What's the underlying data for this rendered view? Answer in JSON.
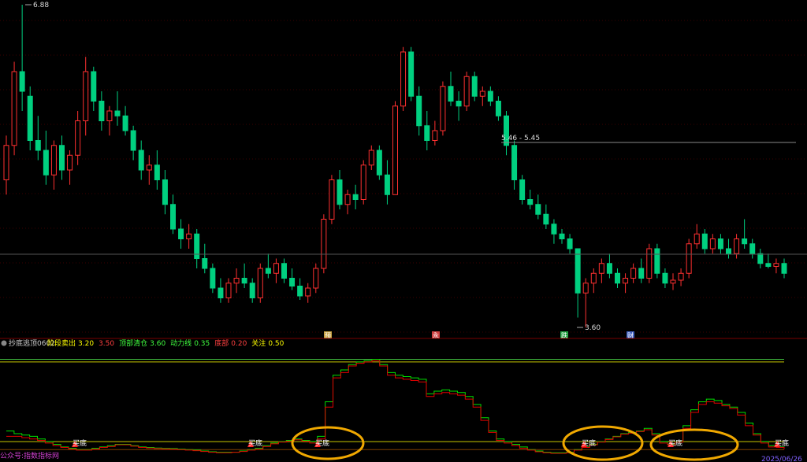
{
  "price_panel": {
    "high_label": "6.88",
    "low_label": "3.60",
    "range_label": "5.46 - 5.45",
    "badges": [
      {
        "text": "预",
        "color": "#c8a040"
      },
      {
        "text": "永",
        "color": "#d04040"
      },
      {
        "text": "跌",
        "color": "#20a040"
      },
      {
        "text": "财",
        "color": "#4060c0"
      }
    ]
  },
  "indicator_header": {
    "name": "抄底逃顶0602",
    "items": [
      {
        "label": "阶段卖出",
        "value": "3.20",
        "color": "#ffff00"
      },
      {
        "label": "",
        "value": "3.50",
        "color": "#ff4040"
      },
      {
        "label": "顶部清仓",
        "value": "3.60",
        "color": "#40ff40"
      },
      {
        "label": "动力线",
        "value": "0.35",
        "color": "#40ff40"
      },
      {
        "label": "底部",
        "value": "0.20",
        "color": "#ff4040"
      },
      {
        "label": "关注",
        "value": "0.50",
        "color": "#ffff00"
      }
    ]
  },
  "signals": [
    "买底",
    "买底",
    "买底",
    "买底",
    "买底",
    "买底"
  ],
  "footer": {
    "left_text": "公众号:指数指标网",
    "right_date": "2025/06/26"
  },
  "colors": {
    "up": "#ff3030",
    "down": "#00d080",
    "grid": "#7a0000",
    "highlight_ellipse": "#f0a800",
    "line_top": "#40c040",
    "line_mid": "#c8c800"
  },
  "chart_data": [
    {
      "type": "candlestick",
      "title": "",
      "y_axis": {
        "high": 6.88,
        "low": 3.6
      },
      "candles": [
        [
          5.1,
          5.55,
          4.95,
          5.45
        ],
        [
          5.45,
          6.3,
          5.35,
          6.2
        ],
        [
          6.2,
          6.88,
          5.8,
          6.0
        ],
        [
          5.95,
          6.05,
          5.4,
          5.5
        ],
        [
          5.5,
          5.75,
          5.3,
          5.4
        ],
        [
          5.4,
          5.6,
          5.05,
          5.15
        ],
        [
          5.15,
          5.5,
          5.0,
          5.45
        ],
        [
          5.45,
          5.55,
          5.1,
          5.2
        ],
        [
          5.2,
          5.4,
          5.05,
          5.35
        ],
        [
          5.35,
          5.8,
          5.25,
          5.7
        ],
        [
          5.7,
          6.35,
          5.55,
          6.2
        ],
        [
          6.2,
          6.25,
          5.8,
          5.9
        ],
        [
          5.9,
          6.0,
          5.6,
          5.7
        ],
        [
          5.7,
          5.85,
          5.55,
          5.8
        ],
        [
          5.8,
          6.0,
          5.65,
          5.75
        ],
        [
          5.75,
          5.85,
          5.55,
          5.6
        ],
        [
          5.6,
          5.65,
          5.3,
          5.4
        ],
        [
          5.4,
          5.5,
          5.1,
          5.2
        ],
        [
          5.2,
          5.35,
          5.05,
          5.25
        ],
        [
          5.25,
          5.4,
          5.0,
          5.1
        ],
        [
          5.1,
          5.2,
          4.75,
          4.85
        ],
        [
          4.85,
          4.95,
          4.55,
          4.6
        ],
        [
          4.6,
          4.7,
          4.4,
          4.5
        ],
        [
          4.5,
          4.65,
          4.4,
          4.55
        ],
        [
          4.55,
          4.6,
          4.2,
          4.3
        ],
        [
          4.3,
          4.45,
          4.15,
          4.2
        ],
        [
          4.2,
          4.25,
          3.95,
          4.0
        ],
        [
          4.0,
          4.1,
          3.85,
          3.9
        ],
        [
          3.9,
          4.1,
          3.85,
          4.05
        ],
        [
          4.05,
          4.2,
          3.95,
          4.1
        ],
        [
          4.1,
          4.25,
          4.0,
          4.05
        ],
        [
          4.05,
          4.1,
          3.85,
          3.9
        ],
        [
          3.9,
          4.25,
          3.85,
          4.2
        ],
        [
          4.2,
          4.35,
          4.1,
          4.15
        ],
        [
          4.15,
          4.3,
          4.05,
          4.25
        ],
        [
          4.25,
          4.3,
          4.05,
          4.1
        ],
        [
          4.1,
          4.2,
          3.98,
          4.02
        ],
        [
          4.02,
          4.1,
          3.88,
          3.92
        ],
        [
          3.92,
          4.05,
          3.85,
          4.0
        ],
        [
          4.0,
          4.25,
          3.95,
          4.2
        ],
        [
          4.2,
          4.75,
          4.15,
          4.7
        ],
        [
          4.7,
          5.15,
          4.65,
          5.1
        ],
        [
          5.1,
          5.2,
          4.8,
          4.85
        ],
        [
          4.85,
          5.0,
          4.75,
          4.95
        ],
        [
          4.95,
          5.05,
          4.8,
          4.9
        ],
        [
          4.9,
          5.3,
          4.85,
          5.25
        ],
        [
          5.25,
          5.45,
          5.2,
          5.4
        ],
        [
          5.4,
          5.45,
          5.1,
          5.15
        ],
        [
          5.15,
          5.3,
          4.85,
          4.95
        ],
        [
          4.95,
          5.9,
          4.95,
          5.85
        ],
        [
          5.85,
          6.45,
          5.8,
          6.4
        ],
        [
          6.4,
          6.45,
          5.9,
          5.95
        ],
        [
          5.95,
          6.05,
          5.55,
          5.65
        ],
        [
          5.65,
          5.8,
          5.4,
          5.5
        ],
        [
          5.5,
          5.7,
          5.45,
          5.6
        ],
        [
          5.6,
          6.1,
          5.55,
          6.05
        ],
        [
          6.05,
          6.2,
          5.85,
          5.9
        ],
        [
          5.9,
          6.0,
          5.7,
          5.85
        ],
        [
          5.85,
          6.2,
          5.8,
          6.15
        ],
        [
          6.15,
          6.2,
          5.9,
          5.95
        ],
        [
          5.95,
          6.05,
          5.85,
          6.0
        ],
        [
          6.0,
          6.05,
          5.85,
          5.9
        ],
        [
          5.9,
          5.95,
          5.7,
          5.75
        ],
        [
          5.75,
          5.8,
          5.35,
          5.45
        ],
        [
          5.45,
          5.5,
          5.0,
          5.1
        ],
        [
          5.1,
          5.15,
          4.85,
          4.9
        ],
        [
          4.9,
          5.0,
          4.8,
          4.85
        ],
        [
          4.85,
          4.95,
          4.7,
          4.75
        ],
        [
          4.75,
          4.85,
          4.6,
          4.65
        ],
        [
          4.65,
          4.7,
          4.45,
          4.55
        ],
        [
          4.55,
          4.6,
          4.45,
          4.5
        ],
        [
          4.5,
          4.55,
          4.35,
          4.4
        ],
        [
          4.4,
          4.35,
          3.7,
          3.95
        ],
        [
          3.95,
          4.1,
          3.6,
          4.05
        ],
        [
          4.05,
          4.2,
          3.95,
          4.15
        ],
        [
          4.15,
          4.3,
          4.05,
          4.25
        ],
        [
          4.25,
          4.35,
          4.1,
          4.15
        ],
        [
          4.15,
          4.2,
          4.0,
          4.05
        ],
        [
          4.05,
          4.15,
          3.95,
          4.1
        ],
        [
          4.1,
          4.25,
          4.05,
          4.2
        ],
        [
          4.2,
          4.3,
          4.05,
          4.1
        ],
        [
          4.1,
          4.45,
          4.05,
          4.4
        ],
        [
          4.4,
          4.45,
          4.1,
          4.15
        ],
        [
          4.15,
          4.2,
          4.0,
          4.05
        ],
        [
          4.05,
          4.15,
          3.98,
          4.08
        ],
        [
          4.08,
          4.2,
          4.02,
          4.15
        ],
        [
          4.15,
          4.5,
          4.1,
          4.45
        ],
        [
          4.45,
          4.65,
          4.4,
          4.55
        ],
        [
          4.55,
          4.6,
          4.35,
          4.4
        ],
        [
          4.4,
          4.55,
          4.35,
          4.5
        ],
        [
          4.5,
          4.55,
          4.35,
          4.4
        ],
        [
          4.4,
          4.5,
          4.3,
          4.35
        ],
        [
          4.35,
          4.55,
          4.3,
          4.5
        ],
        [
          4.5,
          4.7,
          4.4,
          4.45
        ],
        [
          4.45,
          4.5,
          4.3,
          4.35
        ],
        [
          4.35,
          4.4,
          4.2,
          4.25
        ],
        [
          4.25,
          4.35,
          4.2,
          4.22
        ],
        [
          4.22,
          4.3,
          4.15,
          4.25
        ],
        [
          4.25,
          4.3,
          4.1,
          4.15
        ]
      ]
    },
    {
      "type": "line",
      "title": "",
      "y_axis": {
        "min": 0,
        "max": 4
      },
      "reference_lines": [
        3.6,
        3.5,
        0.5,
        0.2
      ],
      "series": [
        {
          "color": "#00e000",
          "values": [
            0.9,
            0.8,
            0.75,
            0.7,
            0.6,
            0.5,
            0.4,
            0.3,
            0.25,
            0.2,
            0.2,
            0.25,
            0.3,
            0.35,
            0.4,
            0.4,
            0.35,
            0.3,
            0.28,
            0.26,
            0.25,
            0.24,
            0.22,
            0.2,
            0.18,
            0.15,
            0.12,
            0.1,
            0.1,
            0.1,
            0.15,
            0.2,
            0.25,
            0.35,
            0.45,
            0.5,
            0.55,
            0.6,
            0.55,
            0.5,
            0.7,
            2.0,
            3.0,
            3.2,
            3.4,
            3.5,
            3.55,
            3.6,
            3.4,
            3.1,
            3.0,
            2.95,
            2.9,
            2.85,
            2.3,
            2.4,
            2.45,
            2.4,
            2.35,
            2.2,
            1.9,
            1.4,
            0.9,
            0.6,
            0.5,
            0.4,
            0.3,
            0.2,
            0.15,
            0.1,
            0.08,
            0.08,
            0.1,
            0.2,
            0.3,
            0.4,
            0.5,
            0.6,
            0.7,
            0.8,
            0.85,
            0.9,
            1.0,
            0.8,
            0.5,
            0.4,
            0.5,
            1.1,
            1.7,
            2.0,
            2.1,
            2.05,
            1.9,
            1.8,
            1.6,
            1.2,
            0.8,
            0.5,
            0.35,
            0.3,
            0.25
          ]
        },
        {
          "color": "#e00000",
          "values": [
            0.7,
            0.7,
            0.65,
            0.6,
            0.55,
            0.45,
            0.35,
            0.28,
            0.22,
            0.18,
            0.18,
            0.22,
            0.28,
            0.32,
            0.38,
            0.38,
            0.33,
            0.28,
            0.26,
            0.24,
            0.23,
            0.22,
            0.2,
            0.18,
            0.16,
            0.13,
            0.1,
            0.08,
            0.08,
            0.1,
            0.13,
            0.18,
            0.22,
            0.32,
            0.42,
            0.48,
            0.52,
            0.57,
            0.52,
            0.45,
            0.6,
            1.8,
            2.9,
            3.1,
            3.35,
            3.45,
            3.5,
            3.55,
            3.35,
            3.0,
            2.9,
            2.85,
            2.8,
            2.75,
            2.2,
            2.3,
            2.35,
            2.3,
            2.25,
            2.1,
            1.8,
            1.3,
            0.85,
            0.55,
            0.45,
            0.35,
            0.25,
            0.18,
            0.12,
            0.08,
            0.06,
            0.06,
            0.08,
            0.18,
            0.28,
            0.38,
            0.48,
            0.58,
            0.68,
            0.78,
            0.82,
            0.88,
            0.95,
            0.75,
            0.45,
            0.38,
            0.48,
            1.0,
            1.6,
            1.9,
            2.0,
            1.95,
            1.85,
            1.75,
            1.5,
            1.1,
            0.75,
            0.45,
            0.3,
            0.28,
            0.22
          ]
        }
      ]
    }
  ]
}
